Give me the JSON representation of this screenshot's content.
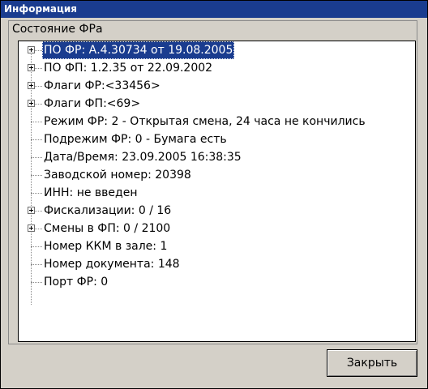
{
  "window": {
    "title": "Информация"
  },
  "group": {
    "label": "Состояние ФРа"
  },
  "tree": {
    "items": [
      {
        "label": "ПО ФР: А.4.30734 от 19.08.2005",
        "expandable": true,
        "selected": true
      },
      {
        "label": "ПО ФП: 1.2.35 от 22.09.2002",
        "expandable": true,
        "selected": false
      },
      {
        "label": "Флаги ФР:<33456>",
        "expandable": true,
        "selected": false
      },
      {
        "label": "Флаги ФП:<69>",
        "expandable": true,
        "selected": false
      },
      {
        "label": "Режим ФР: 2 - Открытая смена, 24 часа не кончились",
        "expandable": false,
        "selected": false
      },
      {
        "label": "Подрежим ФР: 0 - Бумага есть",
        "expandable": false,
        "selected": false
      },
      {
        "label": "Дата/Время: 23.09.2005 16:38:35",
        "expandable": false,
        "selected": false
      },
      {
        "label": "Заводской номер: 20398",
        "expandable": false,
        "selected": false
      },
      {
        "label": "ИНН: не введен",
        "expandable": false,
        "selected": false
      },
      {
        "label": "Фискализации: 0 / 16",
        "expandable": true,
        "selected": false
      },
      {
        "label": "Смены в ФП: 0 / 2100",
        "expandable": true,
        "selected": false
      },
      {
        "label": "Номер ККМ в зале: 1",
        "expandable": false,
        "selected": false
      },
      {
        "label": "Номер документа: 148",
        "expandable": false,
        "selected": false
      },
      {
        "label": "Порт ФР: 0",
        "expandable": false,
        "selected": false
      }
    ]
  },
  "buttons": {
    "close_label": "Закрыть"
  }
}
